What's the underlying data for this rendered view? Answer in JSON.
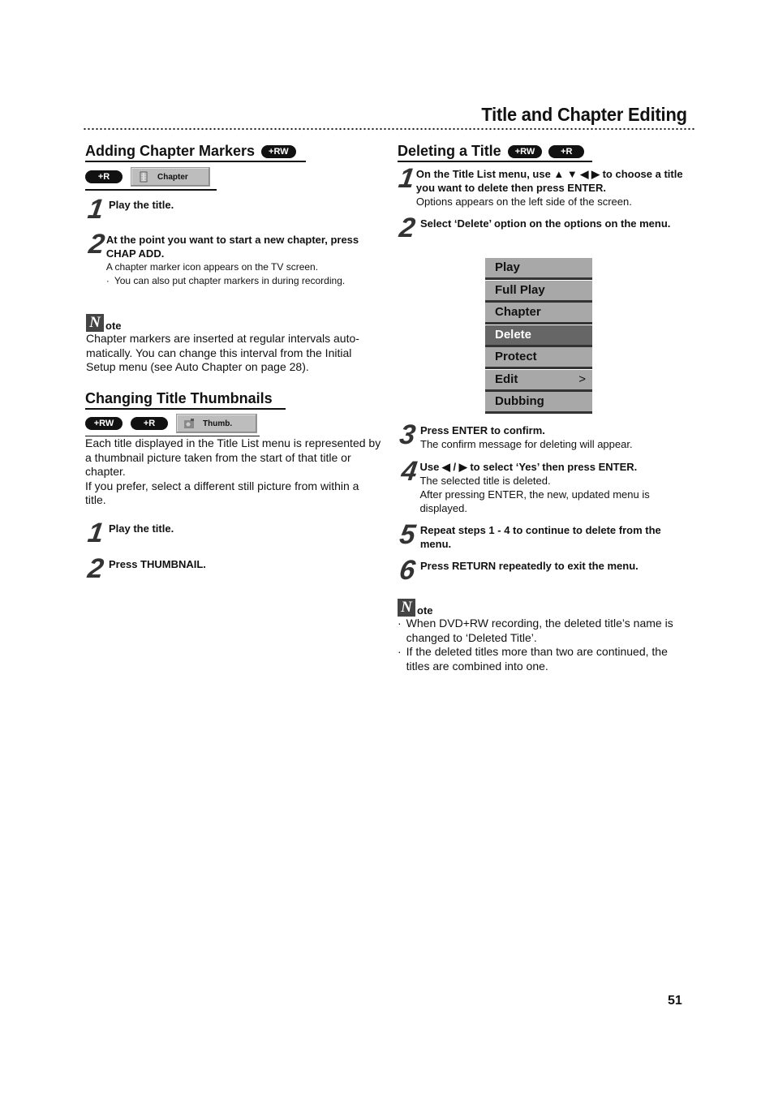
{
  "header": {
    "title": "Title and Chapter Editing"
  },
  "left": {
    "adding": {
      "title": "Adding Chapter Markers",
      "title_badge": "+RW",
      "badges": [
        "+R"
      ],
      "osd_button": "Chapter",
      "steps": [
        {
          "num": "1",
          "bold": "Play the title."
        },
        {
          "num": "2",
          "bold": "At the point you want to start a new chapter, press CHAP ADD.",
          "text": "A chapter marker icon appears on the TV screen.",
          "bullet": "You can also put chapter markers in during recording."
        }
      ],
      "note": {
        "label": "ote",
        "text": "Chapter markers are inserted at regular intervals auto-matically. You can change this interval from the Initial Setup menu (see Auto Chapter on page 28)."
      }
    },
    "thumbnails": {
      "title": "Changing Title Thumbnails",
      "badges": [
        "+RW",
        "+R"
      ],
      "osd_button": "Thumb.",
      "intro": [
        "Each title displayed in the Title List menu is represented by a thumbnail picture taken from the start of that title or chapter.",
        "If you prefer, select a different still picture from within a title."
      ],
      "steps": [
        {
          "num": "1",
          "bold": "Play the title."
        },
        {
          "num": "2",
          "bold": "Press THUMBNAIL."
        }
      ]
    }
  },
  "right": {
    "deleting": {
      "title": "Deleting a Title",
      "badges": [
        "+RW",
        "+R"
      ],
      "steps": [
        {
          "num": "1",
          "bold": "On the Title List menu, use ▲ ▼ ◀ ▶ to choose a title you want to delete then press ENTER.",
          "text": "Options appears on the left side of the screen."
        },
        {
          "num": "2",
          "bold": "Select ‘Delete’ option on the options on the menu."
        },
        {
          "num": "3",
          "bold": "Press ENTER to confirm.",
          "text": "The confirm message for deleting will appear."
        },
        {
          "num": "4",
          "bold": "Use ◀ / ▶ to select ‘Yes’ then press ENTER.",
          "text": "The selected title is deleted.",
          "text2": "After pressing ENTER, the new, updated menu is displayed."
        },
        {
          "num": "5",
          "bold": "Repeat steps 1 - 4 to continue to delete from the menu."
        },
        {
          "num": "6",
          "bold": "Press RETURN repeatedly to exit the menu."
        }
      ],
      "menu": {
        "items": [
          "Play",
          "Full Play",
          "Chapter",
          "Delete",
          "Protect",
          "Edit",
          "Dubbing"
        ],
        "selected": "Delete",
        "submenu_arrow": ">"
      },
      "note": {
        "label": "ote",
        "bullets": [
          "When DVD+RW recording, the deleted title’s name is changed to ‘Deleted Title’.",
          "If the deleted titles more than two are continued, the titles are combined into one."
        ]
      }
    }
  },
  "footer": {
    "page_number": "51"
  }
}
